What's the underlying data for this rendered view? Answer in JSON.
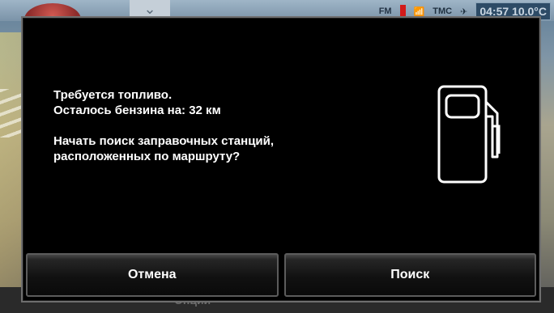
{
  "status_bar": {
    "radio_label": "FM",
    "tmc_label": "TMC",
    "clock_text": "04:57 10.0°C"
  },
  "background": {
    "bottom_button_label": "Опции"
  },
  "dialog": {
    "line1": "Требуется топливо.",
    "line2": "Осталось бензина на: 32 км",
    "line3": "Начать поиск заправочных станций,",
    "line4": "расположенных по маршруту?",
    "icon": "fuel-pump-icon",
    "buttons": {
      "cancel_label": "Отмена",
      "search_label": "Поиск"
    }
  },
  "colors": {
    "dialog_background": "#000000",
    "text": "#ffffff",
    "border": "#6e6e6e"
  }
}
